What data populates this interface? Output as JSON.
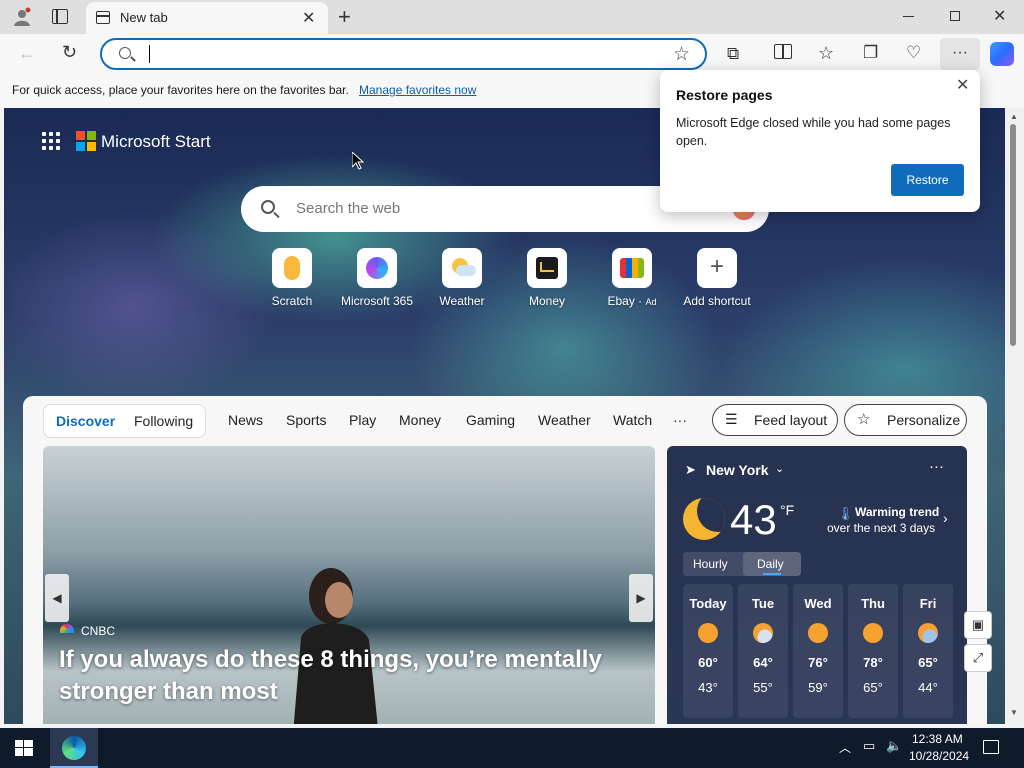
{
  "browser": {
    "tab_title": "New tab",
    "address_value": "",
    "favorites_bar_text": "For quick access, place your favorites here on the favorites bar.",
    "favorites_bar_link": "Manage favorites now"
  },
  "start": {
    "brand": "Microsoft Start",
    "search_placeholder": "Search the web",
    "shortcuts": [
      {
        "label": "Scratch",
        "icon": "scratch-icon"
      },
      {
        "label": "Microsoft 365",
        "icon": "microsoft-365-icon"
      },
      {
        "label": "Weather",
        "icon": "weather-icon"
      },
      {
        "label": "Money",
        "icon": "money-icon"
      },
      {
        "label": "Ebay",
        "icon": "ebay-icon",
        "ad": "Ad"
      },
      {
        "label": "Add shortcut",
        "icon": "plus-icon"
      }
    ]
  },
  "feed": {
    "tabs": [
      "Discover",
      "Following",
      "News",
      "Sports",
      "Play",
      "Money",
      "Gaming",
      "Weather",
      "Watch",
      "···"
    ],
    "feed_layout_label": "Feed layout",
    "personalize_label": "Personalize",
    "hero": {
      "source": "CNBC",
      "headline": "If you always do these 8 things, you’re mentally stronger than most"
    }
  },
  "weather": {
    "location": "New York",
    "temperature": "43",
    "unit": "°F",
    "trend": "Warming trend",
    "trend_detail": "over the next 3 days",
    "toggle": [
      "Hourly",
      "Daily"
    ],
    "days": [
      {
        "day": "Today",
        "high": "60°",
        "low": "43°",
        "icon": "sunny-icon"
      },
      {
        "day": "Tue",
        "high": "64°",
        "low": "55°",
        "icon": "partly-cloudy-icon"
      },
      {
        "day": "Wed",
        "high": "76°",
        "low": "59°",
        "icon": "sunny-icon"
      },
      {
        "day": "Thu",
        "high": "78°",
        "low": "65°",
        "icon": "sunny-icon"
      },
      {
        "day": "Fri",
        "high": "65°",
        "low": "44°",
        "icon": "rain-icon"
      }
    ]
  },
  "popup": {
    "title": "Restore pages",
    "body": "Microsoft Edge closed while you had some pages open.",
    "button": "Restore"
  },
  "taskbar": {
    "time": "12:38 AM",
    "date": "10/28/2024"
  },
  "colors": {
    "accent": "#0f6cbd",
    "taskbar": "#0f1a2b",
    "sun": "#f7a130"
  }
}
